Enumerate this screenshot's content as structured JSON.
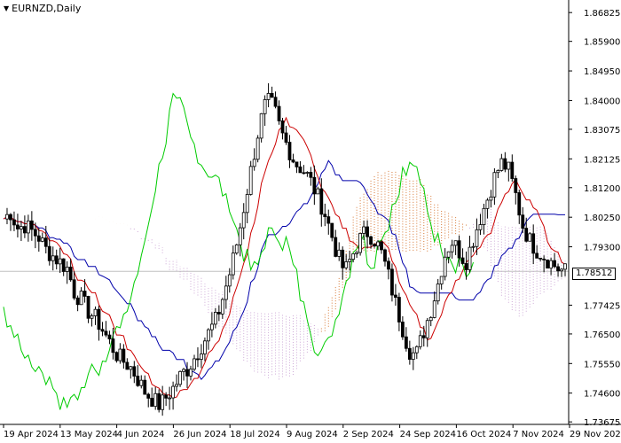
{
  "window": {
    "symbol": "EURNZD",
    "timeframe": "Daily",
    "title": "EURNZD,Daily",
    "menu_icon": "triangle-down-icon"
  },
  "price_axis": {
    "labels": [
      "1.86825",
      "1.85900",
      "1.84950",
      "1.84000",
      "1.83075",
      "1.82125",
      "1.81200",
      "1.80250",
      "1.79300",
      "1.78512",
      "1.77425",
      "1.76500",
      "1.75550",
      "1.74600",
      "1.73675"
    ],
    "current_price": "1.78512",
    "current_price_value": 1.78512
  },
  "time_axis": {
    "labels": [
      "19 Apr 2024",
      "13 May 2024",
      "4 Jun 2024",
      "26 Jun 2024",
      "18 Jul 2024",
      "9 Aug 2024",
      "2 Sep 2024",
      "24 Sep 2024",
      "16 Oct 2024",
      "7 Nov 2024",
      "29 Nov 2024"
    ]
  },
  "colors": {
    "background": "#ffffff",
    "candles": "#000000",
    "tenkan_sen": "#cc0000",
    "kijun_sen": "#0000aa",
    "chikou_span": "#00cc00",
    "cloud_bullish": "#d2691e",
    "cloud_bearish": "#c8a0d2",
    "price_line": "#c0c0c0"
  },
  "chart_data": {
    "type": "candlestick",
    "indicator": "Ichimoku Kinko Hyo",
    "symbol": "EURNZD",
    "timeframe": "Daily",
    "ylim": [
      1.7368,
      1.8683
    ],
    "x_labels": [
      "19 Apr 2024",
      "13 May 2024",
      "4 Jun 2024",
      "26 Jun 2024",
      "18 Jul 2024",
      "9 Aug 2024",
      "2 Sep 2024",
      "24 Sep 2024",
      "16 Oct 2024",
      "7 Nov 2024",
      "29 Nov 2024"
    ],
    "closes": [
      1.802,
      1.804,
      1.799,
      1.8,
      1.798,
      1.796,
      1.792,
      1.79,
      1.788,
      1.786,
      1.778,
      1.776,
      1.772,
      1.77,
      1.766,
      1.762,
      1.758,
      1.756,
      1.754,
      1.75,
      1.746,
      1.744,
      1.742,
      1.745,
      1.748,
      1.752,
      1.754,
      1.758,
      1.762,
      1.766,
      1.77,
      1.778,
      1.786,
      1.796,
      1.808,
      1.82,
      1.832,
      1.84,
      1.838,
      1.83,
      1.825,
      1.82,
      1.818,
      1.815,
      1.81,
      1.805,
      1.798,
      1.79,
      1.785,
      1.79,
      1.795,
      1.798,
      1.796,
      1.792,
      1.785,
      1.776,
      1.768,
      1.76,
      1.758,
      1.765,
      1.772,
      1.78,
      1.79,
      1.795,
      1.792,
      1.788,
      1.795,
      1.802,
      1.808,
      1.815,
      1.82,
      1.818,
      1.81,
      1.8,
      1.795,
      1.792,
      1.79,
      1.788,
      1.786,
      1.7851
    ],
    "current_price": 1.78512
  }
}
